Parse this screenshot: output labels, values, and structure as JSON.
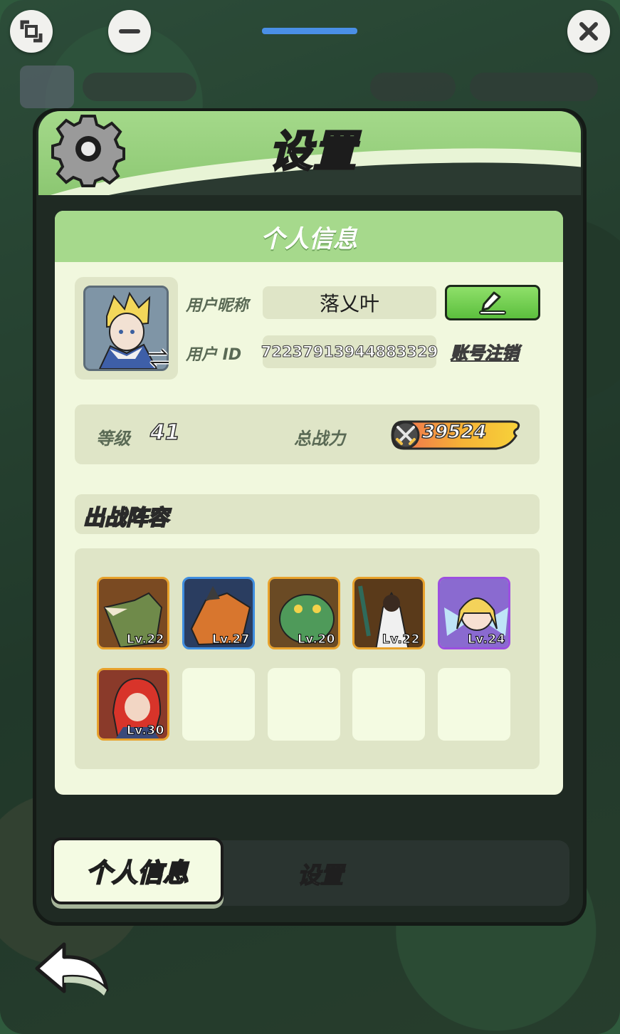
{
  "window": {
    "expand_icon": "expand-icon",
    "minimize_icon": "minimize-icon",
    "close_icon": "close-icon"
  },
  "panel": {
    "title": "设置",
    "section_title": "个人信息"
  },
  "profile": {
    "nickname_label": "用户昵称",
    "nickname": "落乂叶",
    "id_label": "用户 ID",
    "user_id": "72237913944883329",
    "deregister_label": "账号注销"
  },
  "stats": {
    "level_label": "等级",
    "level": "41",
    "power_label": "总战力",
    "power": "39524"
  },
  "lineup": {
    "title": "出战阵容",
    "heroes": [
      {
        "level": "Lv.22",
        "frame": "#e8a22c",
        "bg": "#7a4a22"
      },
      {
        "level": "Lv.27",
        "frame": "#3f8ee0",
        "bg": "#2a3d60"
      },
      {
        "level": "Lv.20",
        "frame": "#e8a22c",
        "bg": "#6a4a24"
      },
      {
        "level": "Lv.22",
        "frame": "#e8a22c",
        "bg": "#5a3a1a"
      },
      {
        "level": "Lv.24",
        "frame": "#9c4fe0",
        "bg": "#8a6ad0"
      },
      {
        "level": "Lv.30",
        "frame": "#e8a22c",
        "bg": "#8a3a2a"
      }
    ]
  },
  "tabs": {
    "personal_info": "个人信息",
    "settings": "设置"
  },
  "colors": {
    "accent_green": "#a6d98c",
    "button_green": "#5cbf3e",
    "drag_bar": "#4a8fe6"
  }
}
